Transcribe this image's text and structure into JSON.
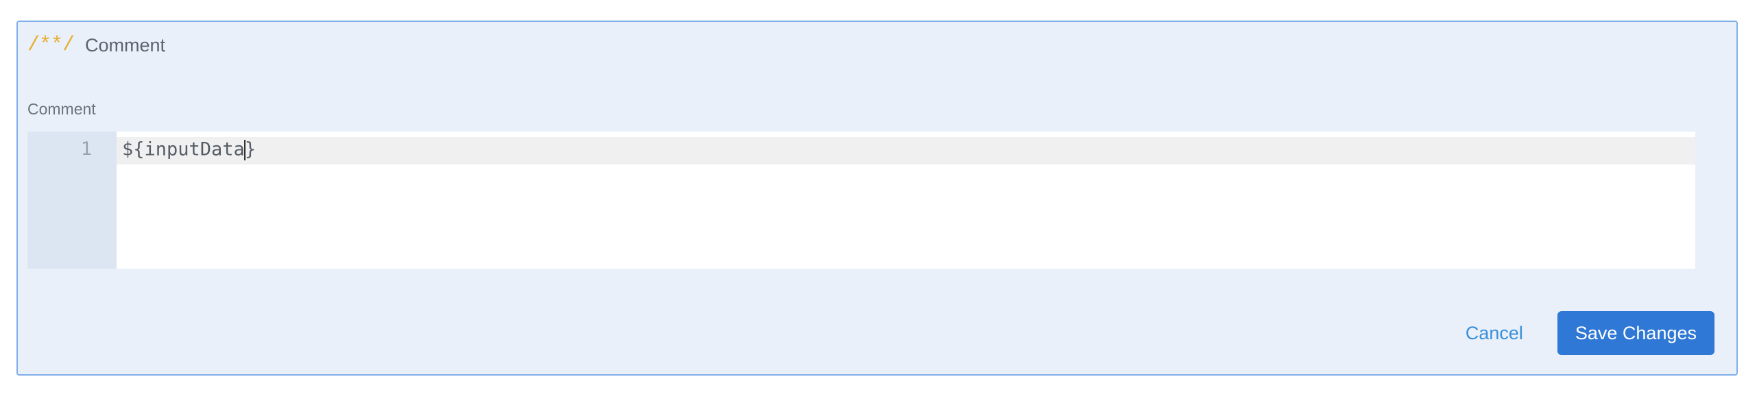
{
  "header": {
    "icon_glyph": "/**/",
    "icon_name": "comment-icon",
    "title": "Comment"
  },
  "field": {
    "label": "Comment"
  },
  "editor": {
    "lines": [
      {
        "number": "1",
        "before_cursor": "${inputData",
        "after_cursor": "}"
      }
    ]
  },
  "actions": {
    "cancel_label": "Cancel",
    "save_label": "Save Changes"
  },
  "colors": {
    "accent": "#2f78d6",
    "link": "#3a8fd9",
    "icon": "#e9ad2e",
    "panel_bg": "#e9f0fa",
    "panel_border": "#7fafea"
  }
}
